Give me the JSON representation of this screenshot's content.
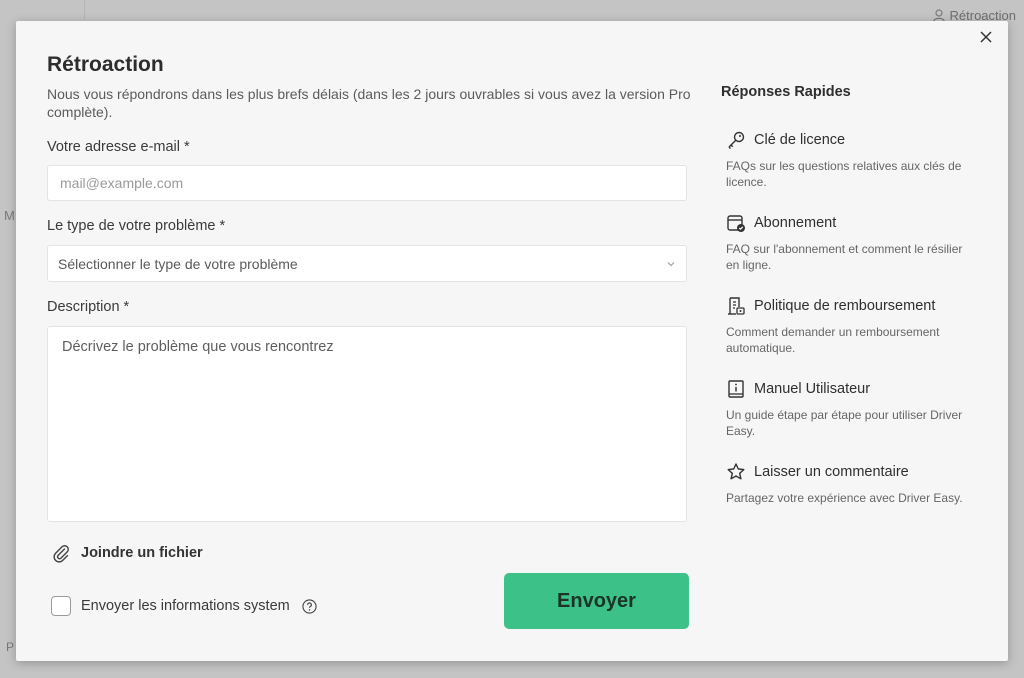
{
  "background": {
    "top_link": "Rétroaction",
    "side_letter_1": "M",
    "side_letter_2": "P"
  },
  "dialog": {
    "title": "Rétroaction",
    "subtitle": "Nous vous répondrons dans les plus brefs délais (dans les 2 jours ouvrables si vous avez la version Pro complète).",
    "email": {
      "label": "Votre adresse e-mail *",
      "placeholder": "mail@example.com",
      "value": ""
    },
    "problem_type": {
      "label": "Le type de votre problème *",
      "selected": "Sélectionner le type de votre problème"
    },
    "description": {
      "label": "Description *",
      "placeholder": "Décrivez le problème que vous rencontrez"
    },
    "attach_label": "Joindre un fichier",
    "system_info_label": "Envoyer les informations system",
    "submit_label": "Envoyer",
    "accent_color": "#3cc289"
  },
  "quick_answers": {
    "title": "Réponses Rapides",
    "items": [
      {
        "icon": "key-icon",
        "label": "Clé de licence",
        "desc": "FAQs sur les questions relatives aux clés de licence."
      },
      {
        "icon": "subscription-icon",
        "label": "Abonnement",
        "desc": "FAQ sur l'abonnement et comment le résilier en ligne."
      },
      {
        "icon": "refund-icon",
        "label": "Politique de remboursement",
        "desc": "Comment demander un remboursement automatique."
      },
      {
        "icon": "manual-icon",
        "label": "Manuel Utilisateur",
        "desc": "Un guide étape par étape pour utiliser Driver Easy."
      },
      {
        "icon": "star-icon",
        "label": "Laisser un commentaire",
        "desc": "Partagez votre expérience avec Driver Easy."
      }
    ]
  }
}
